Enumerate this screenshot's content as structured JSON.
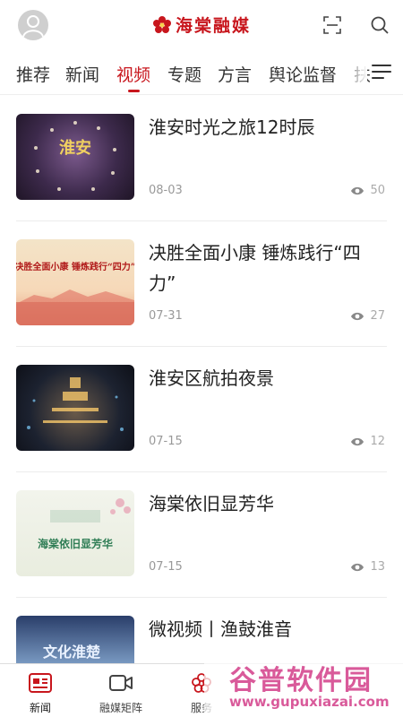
{
  "header": {
    "logo_text": "海棠融媒",
    "icons": {
      "avatar": "user-avatar-icon",
      "scan": "scan-icon",
      "search": "search-icon"
    }
  },
  "tabs": [
    {
      "label": "推荐",
      "active": false
    },
    {
      "label": "新闻",
      "active": false
    },
    {
      "label": "视频",
      "active": true
    },
    {
      "label": "专题",
      "active": false
    },
    {
      "label": "方言",
      "active": false
    },
    {
      "label": "舆论监督",
      "active": false
    },
    {
      "label": "扶",
      "active": false
    }
  ],
  "videos": [
    {
      "title": "淮安时光之旅12时辰",
      "date": "08-03",
      "views": "50",
      "thumb_text": "淮安"
    },
    {
      "title": "决胜全面小康 锤炼践行“四力”",
      "date": "07-31",
      "views": "27",
      "thumb_text": "决胜全面小康 锤炼践行“四力”"
    },
    {
      "title": "淮安区航拍夜景",
      "date": "07-15",
      "views": "12",
      "thumb_text": ""
    },
    {
      "title": "海棠依旧显芳华",
      "date": "07-15",
      "views": "13",
      "thumb_text": "海棠依旧显芳华"
    },
    {
      "title": "微视频丨渔鼓淮音",
      "date": "",
      "views": "",
      "thumb_text": "文化淮楚"
    }
  ],
  "bottom_nav": [
    {
      "label": "新闻",
      "icon": "news-icon",
      "active": true
    },
    {
      "label": "融媒矩阵",
      "icon": "video-camera-icon",
      "active": false
    },
    {
      "label": "服务",
      "icon": "flower-icon",
      "active": false
    }
  ],
  "watermark": {
    "title": "谷普软件园",
    "url": "www.gupuxiazai.com"
  },
  "colors": {
    "accent": "#c8161d",
    "muted": "#999999",
    "divider": "#ececec"
  }
}
